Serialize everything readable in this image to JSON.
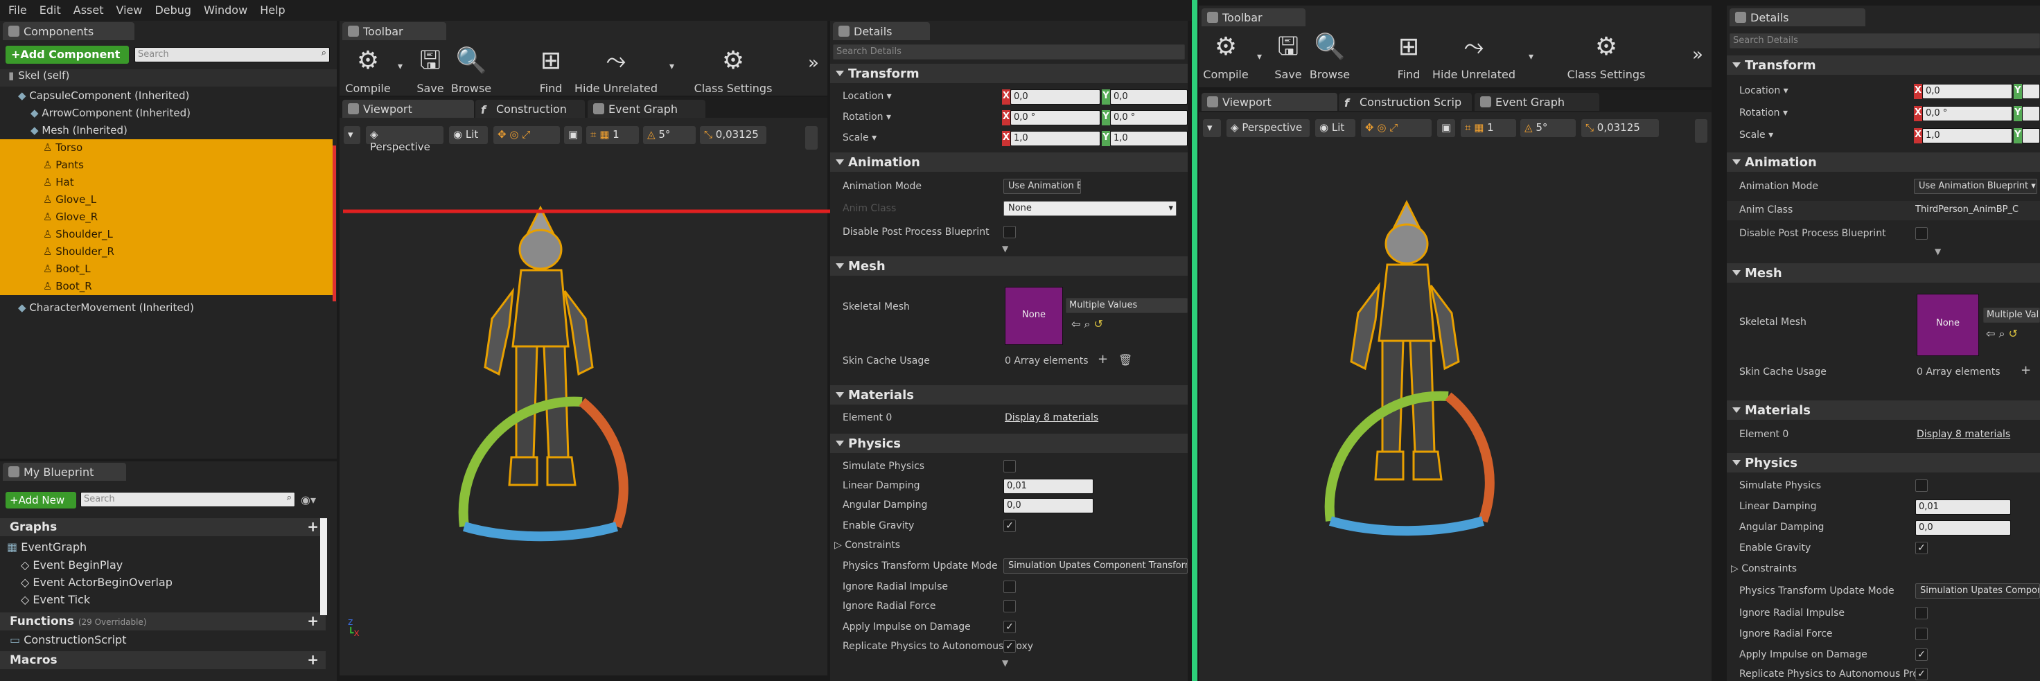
{
  "menu": [
    "File",
    "Edit",
    "Asset",
    "View",
    "Debug",
    "Window",
    "Help"
  ],
  "left": {
    "components_tab": "Components",
    "add_component": "+Add Component",
    "search_placeholder": "Search",
    "skel_self": "Skel (self)",
    "tree": [
      {
        "label": "CapsuleComponent (Inherited)",
        "indent": 1,
        "selected": false
      },
      {
        "label": "ArrowComponent (Inherited)",
        "indent": 2,
        "selected": false
      },
      {
        "label": "Mesh (Inherited)",
        "indent": 2,
        "selected": false
      },
      {
        "label": "Torso",
        "indent": 3,
        "selected": true
      },
      {
        "label": "Pants",
        "indent": 3,
        "selected": true
      },
      {
        "label": "Hat",
        "indent": 3,
        "selected": true
      },
      {
        "label": "Glove_L",
        "indent": 3,
        "selected": true
      },
      {
        "label": "Glove_R",
        "indent": 3,
        "selected": true
      },
      {
        "label": "Shoulder_L",
        "indent": 3,
        "selected": true
      },
      {
        "label": "Shoulder_R",
        "indent": 3,
        "selected": true
      },
      {
        "label": "Boot_L",
        "indent": 3,
        "selected": true
      },
      {
        "label": "Boot_R",
        "indent": 3,
        "selected": true
      },
      {
        "label": "CharacterMovement (Inherited)",
        "indent": 1,
        "selected": false
      }
    ],
    "my_blueprint_tab": "My Blueprint",
    "add_new": "+Add New",
    "bp_search_placeholder": "Search",
    "graphs": "Graphs",
    "event_graph": "EventGraph",
    "events": [
      "Event BeginPlay",
      "Event ActorBeginOverlap",
      "Event Tick"
    ],
    "functions": "Functions",
    "functions_count": "(29 Overridable)",
    "construction_script": "ConstructionScript",
    "macros": "Macros"
  },
  "toolbar": {
    "tab": "Toolbar",
    "buttons": [
      "Compile",
      "Save",
      "Browse",
      "Find",
      "Hide Unrelated",
      "Class Settings"
    ]
  },
  "editor_tabs": [
    "Viewport",
    "Construction Script",
    "Event Graph"
  ],
  "editor_tabs_right": [
    "Viewport",
    "Construction Scrip",
    "Event Graph"
  ],
  "viewport": {
    "perspective": "Perspective",
    "lit": "Lit",
    "grid_count": "1",
    "angle": "5°",
    "scale": "0,03125"
  },
  "details": {
    "tab": "Details",
    "search_placeholder": "Search Details",
    "transform": "Transform",
    "location": "Location",
    "rotation": "Rotation",
    "scale": "Scale",
    "loc_x": "0,0",
    "loc_y": "0,0",
    "rot_x": "0,0 °",
    "rot_y": "0,0 °",
    "scale_x": "1,0",
    "scale_y": "1,0",
    "animation": "Animation",
    "animation_mode": "Animation Mode",
    "animation_mode_value": "Use Animation Blueprint",
    "anim_class": "Anim Class",
    "anim_class_value_left": "None",
    "anim_class_value_right": "ThirdPerson_AnimBP_C",
    "disable_pp": "Disable Post Process Blueprint",
    "mesh": "Mesh",
    "skeletal_mesh": "Skeletal Mesh",
    "thumb_none": "None",
    "multiple_values": "Multiple Values",
    "skin_cache": "Skin Cache Usage",
    "array_elements": "0 Array elements",
    "materials": "Materials",
    "element0": "Element 0",
    "display_materials": "Display 8 materials",
    "physics": "Physics",
    "simulate_physics": "Simulate Physics",
    "linear_damping": "Linear Damping",
    "linear_damping_value": "0,01",
    "angular_damping": "Angular Damping",
    "angular_damping_value": "0,0",
    "enable_gravity": "Enable Gravity",
    "constraints": "Constraints",
    "phys_transform": "Physics Transform Update Mode",
    "phys_transform_value": "Simulation Upates Component Transform",
    "phys_transform_value_right": "Simulation Upates Componen",
    "ignore_radial_impulse": "Ignore Radial Impulse",
    "ignore_radial_force": "Ignore Radial Force",
    "apply_impulse": "Apply Impulse on Damage",
    "replicate_physics": "Replicate Physics to Autonomous Proxy",
    "replicate_physics_short": "Replicate Physics to Autonomous Prox",
    "checkmark": "✓"
  },
  "colors": {
    "selection": "#e8a000",
    "divider": "#2dd07a",
    "arrow": "#e02020",
    "add_btn": "#3a9a2a"
  }
}
